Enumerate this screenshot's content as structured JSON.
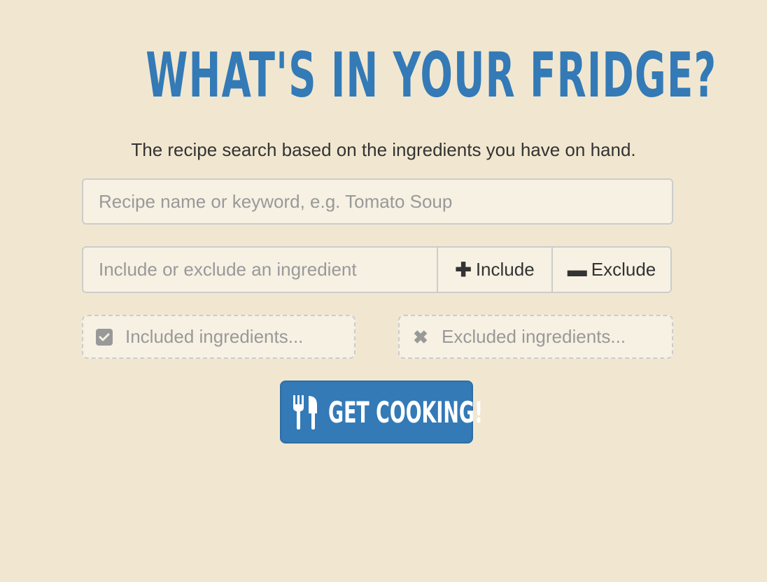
{
  "header": {
    "title": "WHAT'S IN YOUR FRIDGE?",
    "subtitle": "The recipe search based on the ingredients you have on hand."
  },
  "search": {
    "placeholder": "Recipe name or keyword, e.g. Tomato Soup",
    "value": ""
  },
  "ingredient": {
    "placeholder": "Include or exclude an ingredient",
    "value": "",
    "include_label": "Include",
    "exclude_label": "Exclude",
    "include_icon": "plus-icon",
    "exclude_icon": "minus-icon"
  },
  "buckets": {
    "included_placeholder": "Included ingredients...",
    "excluded_placeholder": "Excluded ingredients...",
    "included_icon": "checkbox-icon",
    "excluded_icon": "x-icon"
  },
  "action": {
    "cook_label": "GET COOKING!",
    "cook_icon": "cutlery-icon"
  },
  "colors": {
    "background": "#f1e7d0",
    "accent": "#337ab7",
    "field_bg": "#f7f1e3",
    "muted_text": "#999999"
  }
}
